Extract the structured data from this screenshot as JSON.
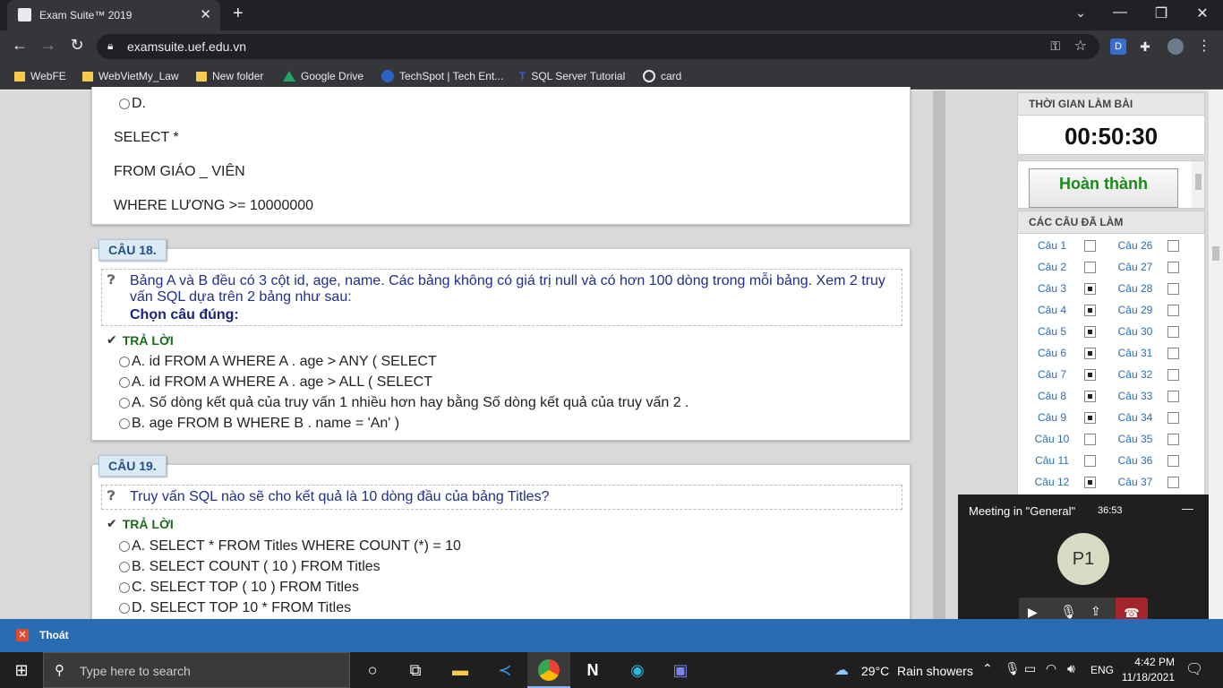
{
  "browser": {
    "tab_title": "Exam Suite™ 2019",
    "new_tab_symbol": "+",
    "url": "examsuite.uef.edu.vn",
    "bookmarks": [
      "WebFE",
      "WebVietMy_Law",
      "New folder",
      "Google Drive",
      "TechSpot | Tech Ent...",
      "SQL Server Tutorial",
      "card"
    ],
    "extension_letter": "D"
  },
  "prev_question": {
    "option_d": "D.",
    "code": [
      "SELECT *",
      "FROM GIÁO _ VIÊN",
      "WHERE LƯƠNG >= 10000000"
    ]
  },
  "q18": {
    "label": "CÂU 18.",
    "text": "Bảng A và B đều có 3 cột id, age, name. Các bảng không có giá trị null và có hơn 100 dòng trong mỗi bảng. Xem 2 truy vấn SQL dựa trên 2 bảng như sau:",
    "instruction": "Chọn câu đúng:",
    "answer_label": "TRẢ LỜI",
    "options": [
      "A. id FROM A WHERE A . age > ANY ( SELECT",
      "A. id FROM A WHERE A . age > ALL ( SELECT",
      "A. Số dòng kết quả của truy vấn 1 nhiều hơn hay bằng Số dòng kết quả của truy vấn 2 .",
      "B. age FROM B WHERE B . name = 'An' )"
    ]
  },
  "q19": {
    "label": "CÂU 19.",
    "text": "Truy vấn SQL nào sẽ cho kết quả là 10 dòng đầu của bảng Titles?",
    "answer_label": "TRẢ LỜI",
    "options": [
      "A. SELECT * FROM Titles WHERE COUNT (*) = 10",
      "B. SELECT COUNT ( 10 ) FROM Titles",
      "C. SELECT TOP ( 10 ) FROM Titles",
      "D. SELECT TOP 10 * FROM Titles"
    ]
  },
  "panel": {
    "timer_title": "THỜI GIAN LÀM BÀI",
    "timer_value": "00:50:30",
    "finish_label": "Hoàn thành",
    "done_title": "CÁC CÂU ĐÃ LÀM",
    "left_col": [
      {
        "name": "Câu 1",
        "done": false
      },
      {
        "name": "Câu 2",
        "done": false
      },
      {
        "name": "Câu 3",
        "done": true
      },
      {
        "name": "Câu 4",
        "done": true
      },
      {
        "name": "Câu 5",
        "done": true
      },
      {
        "name": "Câu 6",
        "done": true
      },
      {
        "name": "Câu 7",
        "done": true
      },
      {
        "name": "Câu 8",
        "done": true
      },
      {
        "name": "Câu 9",
        "done": true
      },
      {
        "name": "Câu 10",
        "done": false
      },
      {
        "name": "Câu 11",
        "done": false
      },
      {
        "name": "Câu 12",
        "done": true
      }
    ],
    "right_col": [
      {
        "name": "Câu 26",
        "done": false
      },
      {
        "name": "Câu 27",
        "done": false
      },
      {
        "name": "Câu 28",
        "done": false
      },
      {
        "name": "Câu 29",
        "done": false
      },
      {
        "name": "Câu 30",
        "done": false
      },
      {
        "name": "Câu 31",
        "done": false
      },
      {
        "name": "Câu 32",
        "done": false
      },
      {
        "name": "Câu 33",
        "done": false
      },
      {
        "name": "Câu 34",
        "done": false
      },
      {
        "name": "Câu 35",
        "done": false
      },
      {
        "name": "Câu 36",
        "done": false
      },
      {
        "name": "Câu 37",
        "done": false
      }
    ]
  },
  "bottom_bar": {
    "exit_label": "Thoát"
  },
  "teams": {
    "title": "Meeting in \"General\"",
    "duration": "36:53",
    "avatar": "P1",
    "minimize": "—"
  },
  "taskbar": {
    "search_placeholder": "Type here to search",
    "weather_temp": "29°C",
    "weather_text": "Rain showers",
    "language": "ENG",
    "time": "4:42 PM",
    "date": "11/18/2021"
  },
  "colors": {
    "accent": "#2a6cb1",
    "finish_text": "#1a8a1a",
    "question_text": "#1f2f8a"
  }
}
